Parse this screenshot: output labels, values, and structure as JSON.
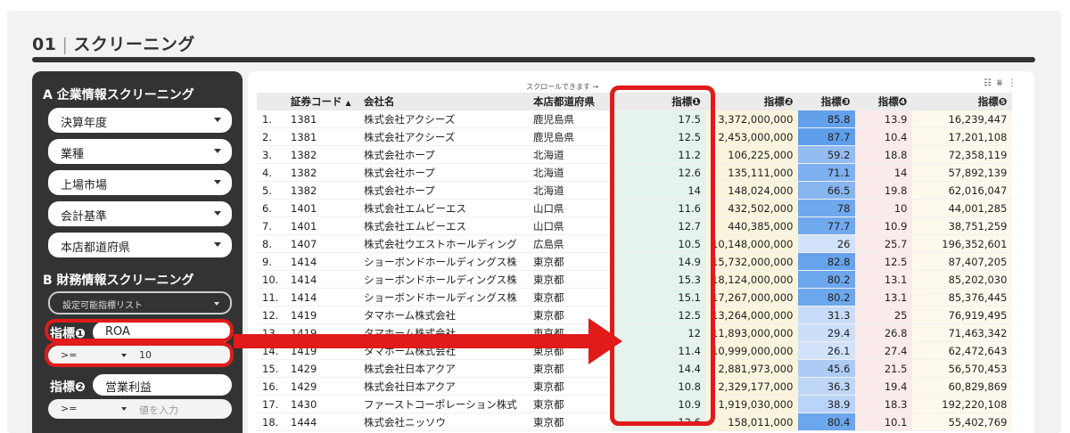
{
  "header": {
    "number": "01",
    "separator": "|",
    "title": "スクリーニング"
  },
  "sidebar": {
    "section_a": "A 企業情報スクリーニング",
    "dropdowns": [
      "決算年度",
      "業種",
      "上場市場",
      "会計基準",
      "本店都道府県"
    ],
    "section_b": "B 財務情報スクリーニング",
    "indicator_list_label": "設定可能指標リスト",
    "indicator1": {
      "label": "指標❶",
      "value": "ROA",
      "operator": ">=",
      "threshold": "10"
    },
    "indicator2": {
      "label": "指標❷",
      "value": "営業利益",
      "operator": ">=",
      "threshold_placeholder": "値を入力"
    }
  },
  "table": {
    "scroll_note": "スクロールできます →",
    "headers": {
      "code": "証券コード",
      "sort_indicator": "▲",
      "name": "会社名",
      "pref": "本店都道府県",
      "i1": "指標❶",
      "i2": "指標❷",
      "i3": "指標❸",
      "i4": "指標❹",
      "i5": "指標❺"
    },
    "rows": [
      {
        "no": "1.",
        "code": "1381",
        "name": "株式会社アクシーズ",
        "pref": "鹿児島県",
        "i1": "17.5",
        "i2": "3,372,000,000",
        "i3": "85.8",
        "i4": "13.9",
        "i5": "16,239,447"
      },
      {
        "no": "2.",
        "code": "1381",
        "name": "株式会社アクシーズ",
        "pref": "鹿児島県",
        "i1": "12.5",
        "i2": "2,453,000,000",
        "i3": "87.7",
        "i4": "10.4",
        "i5": "17,201,108"
      },
      {
        "no": "3.",
        "code": "1382",
        "name": "株式会社ホープ",
        "pref": "北海道",
        "i1": "11.2",
        "i2": "106,225,000",
        "i3": "59.2",
        "i4": "18.8",
        "i5": "72,358,119"
      },
      {
        "no": "4.",
        "code": "1382",
        "name": "株式会社ホープ",
        "pref": "北海道",
        "i1": "12.6",
        "i2": "135,111,000",
        "i3": "71.1",
        "i4": "14",
        "i5": "57,892,139"
      },
      {
        "no": "5.",
        "code": "1382",
        "name": "株式会社ホープ",
        "pref": "北海道",
        "i1": "14",
        "i2": "148,024,000",
        "i3": "66.5",
        "i4": "19.8",
        "i5": "62,016,047"
      },
      {
        "no": "6.",
        "code": "1401",
        "name": "株式会社エムビーエス",
        "pref": "山口県",
        "i1": "11.6",
        "i2": "432,502,000",
        "i3": "78",
        "i4": "10",
        "i5": "44,001,285"
      },
      {
        "no": "7.",
        "code": "1401",
        "name": "株式会社エムビーエス",
        "pref": "山口県",
        "i1": "12.7",
        "i2": "440,385,000",
        "i3": "77.7",
        "i4": "10.9",
        "i5": "38,751,259"
      },
      {
        "no": "8.",
        "code": "1407",
        "name": "株式会社ウエストホールディング",
        "pref": "広島県",
        "i1": "10.5",
        "i2": "10,148,000,000",
        "i3": "26",
        "i4": "25.7",
        "i5": "196,352,601"
      },
      {
        "no": "9.",
        "code": "1414",
        "name": "ショーボンドホールディングス株",
        "pref": "東京都",
        "i1": "14.9",
        "i2": "15,732,000,000",
        "i3": "82.8",
        "i4": "12.5",
        "i5": "87,407,205"
      },
      {
        "no": "10.",
        "code": "1414",
        "name": "ショーボンドホールディングス株",
        "pref": "東京都",
        "i1": "15.3",
        "i2": "18,124,000,000",
        "i3": "80.2",
        "i4": "13.1",
        "i5": "85,202,030"
      },
      {
        "no": "11.",
        "code": "1414",
        "name": "ショーボンドホールディングス株",
        "pref": "東京都",
        "i1": "15.1",
        "i2": "17,267,000,000",
        "i3": "80.2",
        "i4": "13.1",
        "i5": "85,376,445"
      },
      {
        "no": "12.",
        "code": "1419",
        "name": "タマホーム株式会社",
        "pref": "東京都",
        "i1": "12.5",
        "i2": "13,264,000,000",
        "i3": "31.3",
        "i4": "25",
        "i5": "76,919,495"
      },
      {
        "no": "13.",
        "code": "1419",
        "name": "タマホーム株式会社",
        "pref": "東京都",
        "i1": "12",
        "i2": "11,893,000,000",
        "i3": "29.4",
        "i4": "26.8",
        "i5": "71,463,342"
      },
      {
        "no": "14.",
        "code": "1419",
        "name": "タマホーム株式会社",
        "pref": "東京都",
        "i1": "11.4",
        "i2": "10,999,000,000",
        "i3": "26.1",
        "i4": "27.4",
        "i5": "62,472,643"
      },
      {
        "no": "15.",
        "code": "1429",
        "name": "株式会社日本アクア",
        "pref": "東京都",
        "i1": "14.4",
        "i2": "2,881,973,000",
        "i3": "45.6",
        "i4": "21.5",
        "i5": "56,570,453"
      },
      {
        "no": "16.",
        "code": "1429",
        "name": "株式会社日本アクア",
        "pref": "東京都",
        "i1": "10.8",
        "i2": "2,329,177,000",
        "i3": "36.3",
        "i4": "19.4",
        "i5": "60,829,869"
      },
      {
        "no": "17.",
        "code": "1430",
        "name": "ファーストコーポレーション株式",
        "pref": "東京都",
        "i1": "10.9",
        "i2": "1,919,030,000",
        "i3": "38.9",
        "i4": "18.3",
        "i5": "192,220,108"
      },
      {
        "no": "18.",
        "code": "1444",
        "name": "株式会社ニッソウ",
        "pref": "東京都",
        "i1": "12.6",
        "i2": "158,011,000",
        "i3": "80.4",
        "i4": "10.1",
        "i5": "55,402,769"
      }
    ]
  },
  "colors": {
    "highlight": "#e11a1a",
    "sidebar_bg": "#333333",
    "indicator3_scale": [
      "#dce9fb",
      "#5a9bea"
    ]
  }
}
